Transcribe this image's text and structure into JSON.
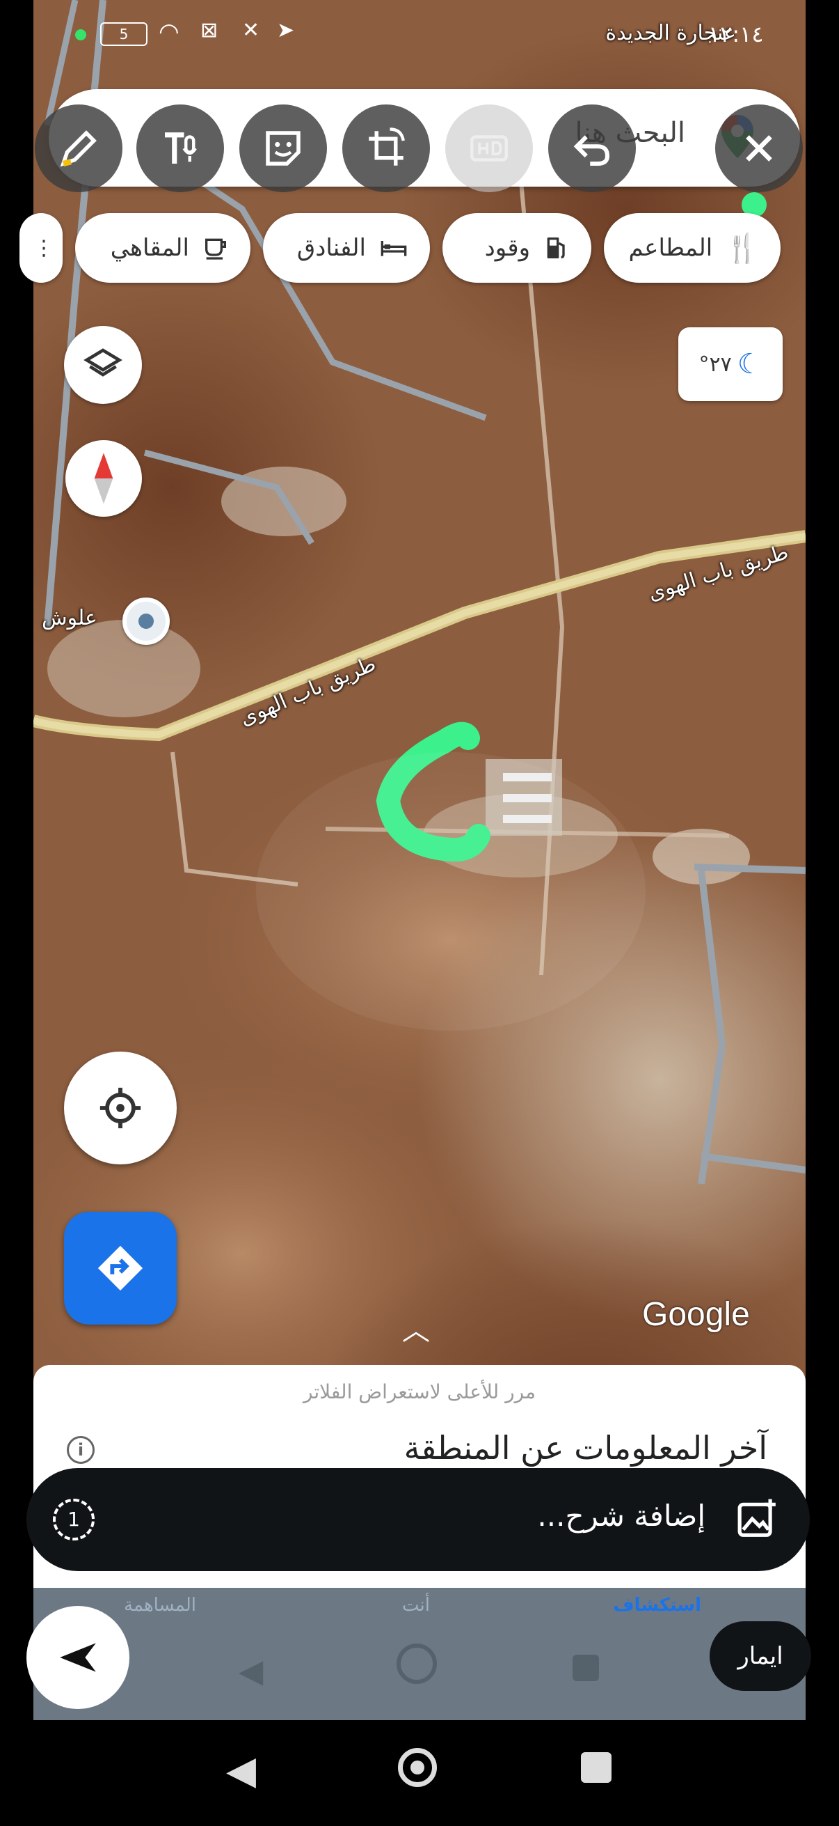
{
  "status_bar": {
    "time": "١٢:١٤",
    "battery": "5",
    "place_name": "عنجارة الجديدة"
  },
  "search": {
    "placeholder": "البحث هنا"
  },
  "categories": [
    {
      "label": "المطاعم",
      "icon": "fork-knife-icon"
    },
    {
      "label": "وقود",
      "icon": "fuel-pump-icon"
    },
    {
      "label": "الفنادق",
      "icon": "bed-icon"
    },
    {
      "label": "المقاهي",
      "icon": "coffee-cup-icon"
    }
  ],
  "weather": {
    "temp": "٢٧°",
    "icon": "moon-icon"
  },
  "map": {
    "road_label_1": "طريق باب الهوى",
    "road_label_2": "طريق باب الهوى",
    "pin_label": "علوش",
    "watermark": "Google"
  },
  "bottom_sheet": {
    "hint": "مرر للأعلى لاستعراض الفلاتر",
    "title": "آخر المعلومات عن المنطقة"
  },
  "bottom_nav": {
    "explore": "استكشاف",
    "you": "أنت",
    "contribute": "المساهمة"
  },
  "caption": {
    "placeholder": "إضافة شرح...",
    "timer_label": "1"
  },
  "recipient": {
    "name": "ايمار"
  },
  "colors": {
    "accent_blue": "#1a73e8",
    "drawing_green": "#3cf08c",
    "caption_bar": "#111417"
  }
}
